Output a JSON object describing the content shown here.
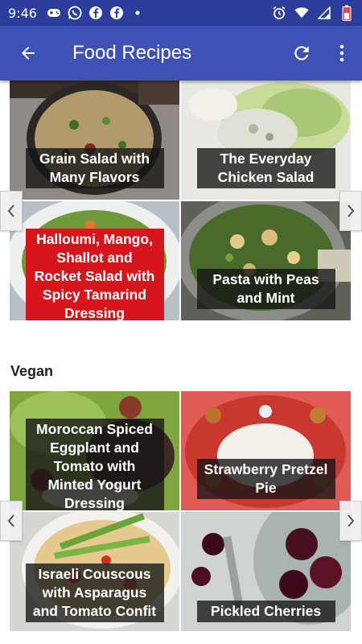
{
  "status_bar": {
    "time": "9:46",
    "left_icons": [
      "gamepad-icon",
      "whatsapp-icon",
      "facebook-icon",
      "facebook-icon",
      "dot-icon"
    ],
    "right_icons": [
      "alarm-icon",
      "wifi-icon",
      "signal-icon",
      "battery-icon"
    ]
  },
  "app_bar": {
    "title": "Food Recipes",
    "back_icon": "arrow-left-icon",
    "refresh_icon": "refresh-icon",
    "menu_icon": "more-vert-icon"
  },
  "sections": [
    {
      "title": "",
      "recipes": [
        {
          "title": "Grain Salad with Many Flavors",
          "caption_color": "dark"
        },
        {
          "title": "The Everyday Chicken Salad",
          "caption_color": "dark"
        },
        {
          "title": "Halloumi, Mango, Shallot and Rocket Salad with Spicy Tamarind Dressing",
          "caption_color": "red"
        },
        {
          "title": "Pasta with Peas and Mint",
          "caption_color": "dark"
        }
      ]
    },
    {
      "title": "Vegan",
      "recipes": [
        {
          "title": "Moroccan Spiced Eggplant and Tomato with Minted Yogurt Dressing",
          "caption_color": "dark"
        },
        {
          "title": "Strawberry Pretzel Pie",
          "caption_color": "dark"
        },
        {
          "title": "Israeli Couscous with Asparagus and Tomato Confit",
          "caption_color": "dark"
        },
        {
          "title": "Pickled Cherries",
          "caption_color": "dark"
        }
      ]
    }
  ],
  "colors": {
    "status_bar": "#2c3d9b",
    "app_bar": "#3f51b5",
    "caption_dark": "#141414",
    "caption_red": "#d6161c"
  }
}
